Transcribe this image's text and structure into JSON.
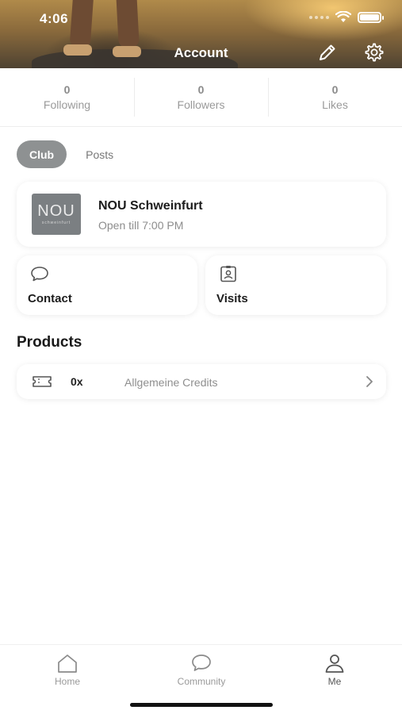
{
  "status_bar": {
    "time": "4:06"
  },
  "header": {
    "title": "Account",
    "edit_icon": "pencil-icon",
    "settings_icon": "gear-icon"
  },
  "stats": [
    {
      "value": "0",
      "label": "Following"
    },
    {
      "value": "0",
      "label": "Followers"
    },
    {
      "value": "0",
      "label": "Likes"
    }
  ],
  "tabs": [
    {
      "label": "Club",
      "active": true
    },
    {
      "label": "Posts",
      "active": false
    }
  ],
  "club": {
    "logo_text": "NOU",
    "logo_subtext": "schweinfurt",
    "name": "NOU Schweinfurt",
    "hours": "Open till 7:00 PM"
  },
  "tiles": [
    {
      "label": "Contact",
      "icon": "chat-bubble-icon"
    },
    {
      "label": "Visits",
      "icon": "badge-icon"
    }
  ],
  "products": {
    "title": "Products",
    "items": [
      {
        "quantity": "0x",
        "name": "Allgemeine Credits",
        "icon": "ticket-icon"
      }
    ]
  },
  "bottom_nav": [
    {
      "label": "Home",
      "icon": "home-icon",
      "active": false
    },
    {
      "label": "Community",
      "icon": "chat-bubble-icon",
      "active": false
    },
    {
      "label": "Me",
      "icon": "person-icon",
      "active": true
    }
  ],
  "colors": {
    "tab_active_bg": "#8e9192",
    "logo_bg": "#7b7f82"
  }
}
